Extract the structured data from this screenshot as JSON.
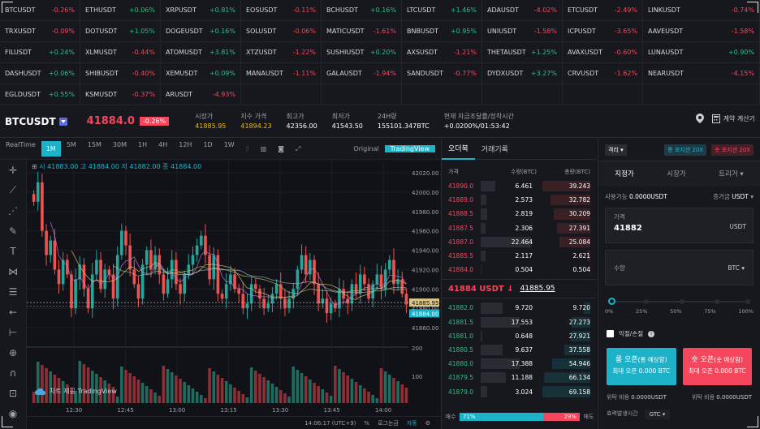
{
  "ticker": [
    [
      [
        "BTCUSDT",
        "-0.26%",
        "dn"
      ],
      [
        "ETHUSDT",
        "+0.06%",
        "up"
      ],
      [
        "XRPUSDT",
        "+0.81%",
        "up"
      ],
      [
        "EOSUSDT",
        "-0.11%",
        "dn"
      ],
      [
        "BCHUSDT",
        "+0.16%",
        "up"
      ],
      [
        "LTCUSDT",
        "+1.46%",
        "up"
      ],
      [
        "ADAUSDT",
        "-4.02%",
        "dn"
      ],
      [
        "ETCUSDT",
        "-2.49%",
        "dn"
      ],
      [
        "LINKUSDT",
        "-0.74%",
        "dn"
      ]
    ],
    [
      [
        "TRXUSDT",
        "-0.09%",
        "dn"
      ],
      [
        "DOTUSDT",
        "+1.05%",
        "up"
      ],
      [
        "DOGEUSDT",
        "+0.16%",
        "up"
      ],
      [
        "SOLUSDT",
        "-0.06%",
        "dn"
      ],
      [
        "MATICUSDT",
        "-1.61%",
        "dn"
      ],
      [
        "BNBUSDT",
        "+0.95%",
        "up"
      ],
      [
        "UNIUSDT",
        "-1.58%",
        "dn"
      ],
      [
        "ICPUSDT",
        "-3.65%",
        "dn"
      ],
      [
        "AAVEUSDT",
        "-1.58%",
        "dn"
      ]
    ],
    [
      [
        "FILUSDT",
        "+0.24%",
        "up"
      ],
      [
        "XLMUSDT",
        "-0.44%",
        "dn"
      ],
      [
        "ATOMUSDT",
        "+3.81%",
        "up"
      ],
      [
        "XTZUSDT",
        "-1.22%",
        "dn"
      ],
      [
        "SUSHIUSDT",
        "+0.20%",
        "up"
      ],
      [
        "AXSUSDT",
        "-1.21%",
        "dn"
      ],
      [
        "THETAUSDT",
        "+1.25%",
        "up"
      ],
      [
        "AVAXUSDT",
        "-0.60%",
        "dn"
      ],
      [
        "LUNAUSDT",
        "+0.90%",
        "up"
      ]
    ],
    [
      [
        "DASHUSDT",
        "+0.06%",
        "up"
      ],
      [
        "SHIBUSDT",
        "-0.40%",
        "dn"
      ],
      [
        "XEMUSDT",
        "+0.09%",
        "up"
      ],
      [
        "MANAUSDT",
        "-1.11%",
        "dn"
      ],
      [
        "GALAUSDT",
        "-1.94%",
        "dn"
      ],
      [
        "SANDUSDT",
        "-0.77%",
        "dn"
      ],
      [
        "DYDXUSDT",
        "+3.27%",
        "up"
      ],
      [
        "CRVUSDT",
        "-1.62%",
        "dn"
      ],
      [
        "NEARUSDT",
        "-4.15%",
        "dn"
      ]
    ],
    [
      [
        "EGLDUSDT",
        "+0.55%",
        "up"
      ],
      [
        "KSMUSDT",
        "-0.37%",
        "dn"
      ],
      [
        "ARUSDT",
        "-4.93%",
        "dn"
      ]
    ]
  ],
  "header": {
    "symbol": "BTCUSDT",
    "price": "41884.0",
    "change": "-0.26%",
    "stats": [
      {
        "label": "시장가",
        "value": "41885.95",
        "yellow": true
      },
      {
        "label": "지수 가격",
        "value": "41894.23",
        "yellow": true
      },
      {
        "label": "최고가",
        "value": "42356.00"
      },
      {
        "label": "최저가",
        "value": "41543.50"
      },
      {
        "label": "24H량",
        "value": "155101.347BTC"
      },
      {
        "label": "현재 자금조달률/정착시간",
        "value": "+0.0200%/01:53:42"
      }
    ],
    "calc_label": "계약 계산기"
  },
  "chart_toolbar": {
    "items": [
      "RealTime",
      "1M",
      "5M",
      "15M",
      "30M",
      "1H",
      "4H",
      "12H",
      "1D",
      "1W"
    ],
    "active": "1M",
    "original": "Original",
    "tradingview": "TradingView"
  },
  "chart": {
    "ohlc_label": "시 41883.00  고 41884.00  저 41882.00  종 41884.00",
    "yticks": [
      "42020.00",
      "42000.00",
      "41980.00",
      "41960.00",
      "41940.00",
      "41920.00",
      "41900.00",
      "41880.00",
      "41860.00"
    ],
    "last_price_tag": "41885.95",
    "price_tag": "41884.00",
    "vol_ticks": [
      "200",
      "100"
    ],
    "xticks": [
      "12:30",
      "12:45",
      "13:00",
      "13:15",
      "13:30",
      "13:45",
      "14:00"
    ],
    "watermark": "차트 제공 TradingView",
    "time": "14:06:17 (UTC+9)",
    "pct": "%",
    "log": "로그눈금",
    "auto": "자동"
  },
  "chart_data": {
    "type": "candlestick",
    "ylim": [
      41845,
      42025
    ],
    "close": [
      41990,
      42010,
      41960,
      41935,
      41950,
      41920,
      41905,
      41930,
      41915,
      41880,
      41910,
      41925,
      41900,
      41880,
      41915,
      41930,
      41900,
      41920,
      41915,
      41890,
      41935,
      41960,
      41945,
      41920,
      41905,
      41890,
      41925,
      41940,
      41920,
      41935,
      41915,
      41895,
      41910,
      41930,
      41905,
      41895,
      41915,
      41925,
      41935,
      41945,
      41955,
      41935,
      41910,
      41935,
      41895,
      41890,
      41905,
      41915,
      41900,
      41895,
      41880,
      41885,
      41905,
      41900,
      41890,
      41880,
      41885,
      41895,
      41905,
      41890,
      41880,
      41890,
      41900,
      41920,
      41935,
      41915,
      41930,
      41905,
      41885,
      41890,
      41875,
      41885,
      41880,
      41900,
      41890,
      41885,
      41905,
      41895,
      41915,
      41905,
      41890,
      41905,
      41915,
      41900,
      41920,
      41930,
      41905,
      41910,
      41895,
      41884
    ]
  },
  "orderbook": {
    "tabs": [
      "오더북",
      "거래기록"
    ],
    "cols": [
      "가격",
      "수량(BTC)",
      "총량(BTC)"
    ],
    "asks": [
      [
        "41890.0",
        "6.461",
        "39.243"
      ],
      [
        "41889.0",
        "2.573",
        "32.782"
      ],
      [
        "41888.5",
        "2.819",
        "30.209"
      ],
      [
        "41887.5",
        "2.306",
        "27.391"
      ],
      [
        "41887.0",
        "22.464",
        "25.084"
      ],
      [
        "41885.5",
        "2.117",
        "2.621"
      ],
      [
        "41884.0",
        "0.504",
        "0.504"
      ]
    ],
    "last": "41884 USDT ↓",
    "mark": "41885.95",
    "bids": [
      [
        "41882.0",
        "9.720",
        "9.720"
      ],
      [
        "41881.5",
        "17.553",
        "27.273"
      ],
      [
        "41881.0",
        "0.648",
        "27.921"
      ],
      [
        "41880.5",
        "9.637",
        "37.558"
      ],
      [
        "41880.0",
        "17.388",
        "54.946"
      ],
      [
        "41879.5",
        "11.188",
        "66.134"
      ],
      [
        "41879.0",
        "3.024",
        "69.158"
      ]
    ],
    "buy_label": "매수",
    "buy_pct": "71%",
    "sell_pct": "29%",
    "sell_label": "매도"
  },
  "trade": {
    "mode": "격리",
    "long_lev": "롱 포지션 20X",
    "short_lev": "숏 포지션 20X",
    "tabs": [
      "지정가",
      "시장가",
      "트리거"
    ],
    "avail_label": "사용가능",
    "avail": "0.0000USDT",
    "margin_label": "증거금",
    "margin_unit": "USDT",
    "price_label": "가격",
    "price": "41882",
    "price_unit": "USDT",
    "qty_label": "수량",
    "qty_unit": "BTC",
    "slider_labels": [
      "0%",
      "25%",
      "50%",
      "75%",
      "100%"
    ],
    "tpsl": "익절/손절",
    "long_btn": "롱 오픈",
    "long_sub": "(롱 예상함)",
    "long_max": "최대 오픈 0.000 BTC",
    "short_btn": "숏 오픈",
    "short_sub": "(숏 예상함)",
    "short_max": "최대 오픈 0.000 BTC",
    "margin_rate_label": "위탁 비용",
    "margin_rate_l": "0.0000USDT",
    "margin_rate_r": "0.0000USDT",
    "tif_label": "효력발생시간",
    "tif": "GTC"
  }
}
